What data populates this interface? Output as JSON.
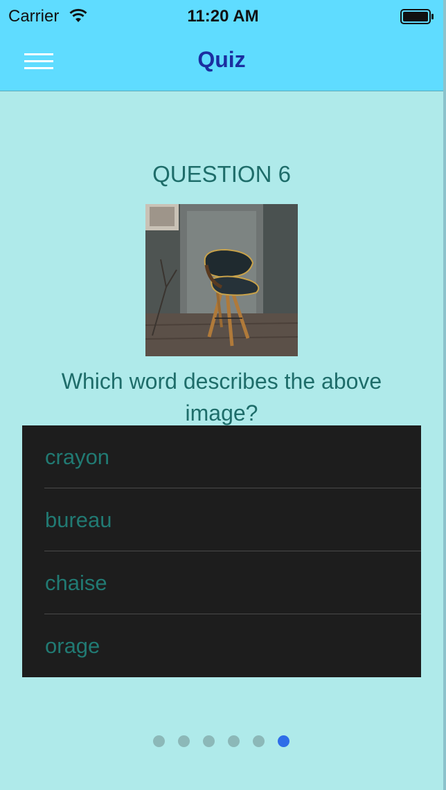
{
  "status_bar": {
    "carrier": "Carrier",
    "time": "11:20 AM",
    "icons": [
      "wifi-icon",
      "battery-icon"
    ]
  },
  "nav_bar": {
    "menu_icon": "hamburger-menu-icon",
    "title": "Quiz"
  },
  "question": {
    "heading": "QUESTION 6",
    "image": "chair-photo",
    "text": "Which word describes the above image?"
  },
  "answers": [
    {
      "label": "crayon"
    },
    {
      "label": "bureau"
    },
    {
      "label": "chaise"
    },
    {
      "label": "orage"
    }
  ],
  "pager": {
    "total": 6,
    "current": 6
  },
  "colors": {
    "background": "#afeaea",
    "navbar": "#5fdcff",
    "title": "#1b2ea0",
    "text_teal": "#1e6d6a",
    "answers_bg": "#1d1d1d",
    "active_dot": "#2f6de8",
    "inactive_dot": "#8cb8b8"
  }
}
